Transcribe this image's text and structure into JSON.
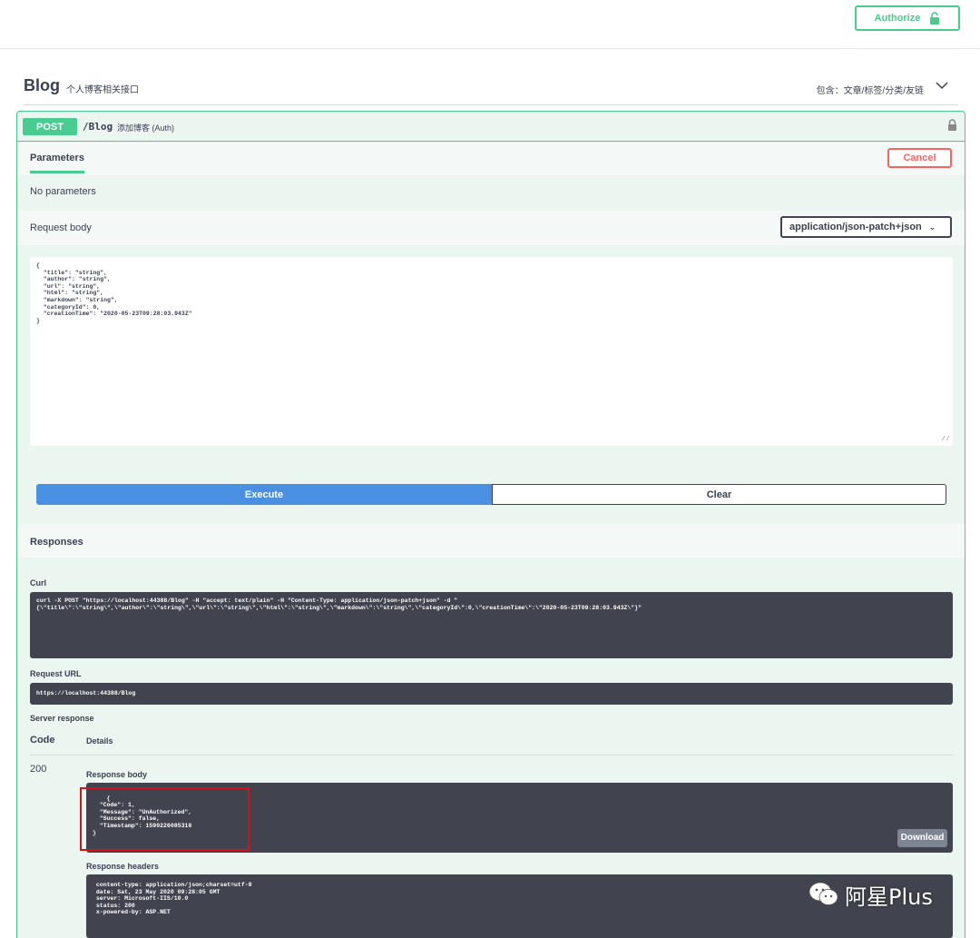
{
  "topbar": {
    "authorize_label": "Authorize"
  },
  "tag": {
    "name": "Blog",
    "description": "个人博客相关接口",
    "extra": "包含：文章/标签/分类/友链"
  },
  "operation": {
    "method": "POST",
    "path": "/Blog",
    "summary": "添加博客 (Auth)",
    "parameters_tab": "Parameters",
    "cancel_label": "Cancel",
    "no_parameters": "No parameters",
    "request_body_label": "Request body",
    "content_type": "application/json-patch+json",
    "request_body": "{\n  \"title\": \"string\",\n  \"author\": \"string\",\n  \"url\": \"string\",\n  \"html\": \"string\",\n  \"markdown\": \"string\",\n  \"categoryId\": 0,\n  \"creationTime\": \"2020-05-23T09:28:03.943Z\"\n}",
    "execute_label": "Execute",
    "clear_label": "Clear"
  },
  "responses": {
    "title": "Responses",
    "curl_label": "Curl",
    "curl": "curl -X POST \"https://localhost:44388/Blog\" -H \"accept: text/plain\" -H \"Content-Type: application/json-patch+json\" -d \"\n{\\\"title\\\":\\\"string\\\",\\\"author\\\":\\\"string\\\",\\\"url\\\":\\\"string\\\",\\\"html\\\":\\\"string\\\",\\\"markdown\\\":\\\"string\\\",\\\"categoryId\\\":0,\\\"creationTime\\\":\\\"2020-05-23T09:28:03.943Z\\\"}\"",
    "request_url_label": "Request URL",
    "request_url": "https://localhost:44388/Blog",
    "server_response_label": "Server response",
    "code_header": "Code",
    "details_header": "Details",
    "status_code": "200",
    "response_body_label": "Response body",
    "response_body": "{\n  \"Code\": 1,\n  \"Message\": \"UnAuthorized\",\n  \"Success\": false,\n  \"Timestamp\": 1590226085318\n}",
    "download_label": "Download",
    "response_headers_label": "Response headers",
    "response_headers": " content-type: application/json;charset=utf-8\n date: Sat, 23 May 2020 09:28:05 GMT\n server: Microsoft-IIS/10.0\n status: 200\n x-powered-by: ASP.NET"
  },
  "watermark": {
    "text": "阿星Plus",
    "icon": "wechat-icon"
  },
  "colors": {
    "post": "#49cc90",
    "execute": "#4990e2",
    "cancel": "#ff6060",
    "code_bg": "#41444e",
    "highlight": "#d0141a"
  }
}
